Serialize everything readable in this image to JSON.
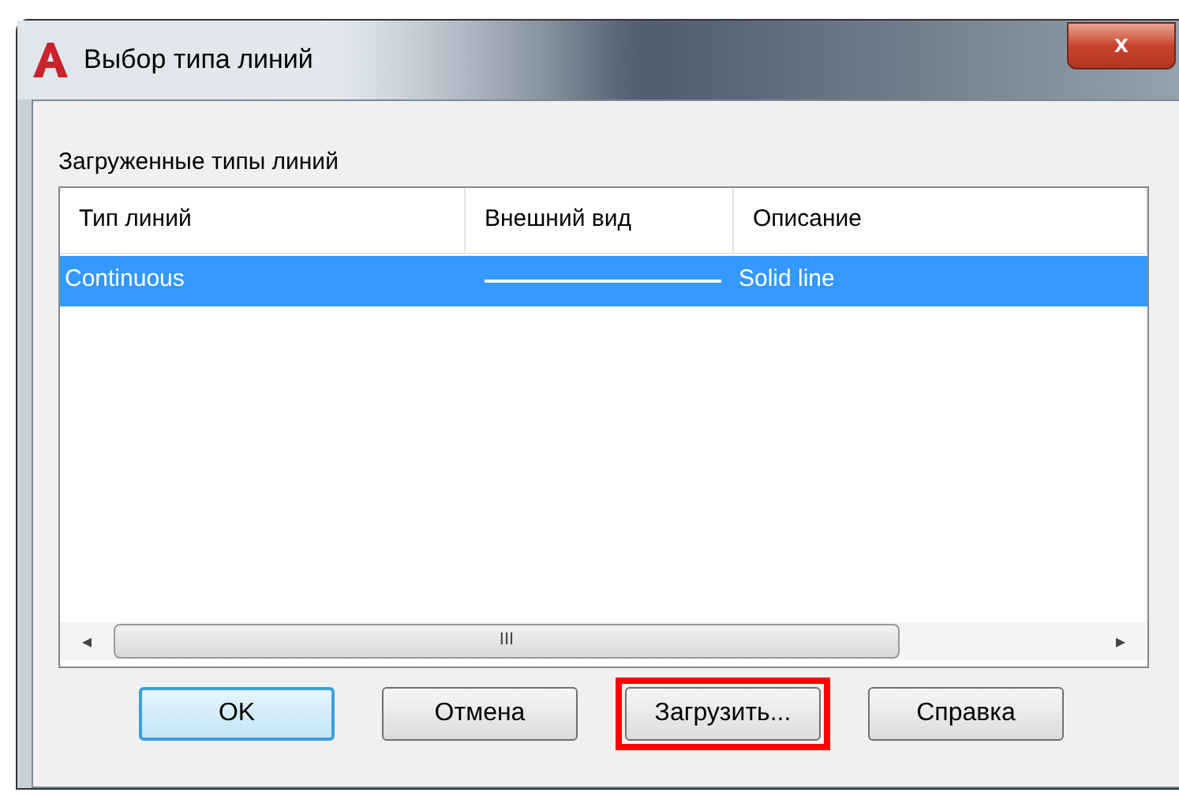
{
  "window": {
    "title": "Выбор типа линий",
    "close": "x"
  },
  "list_label": "Загруженные типы линий",
  "table": {
    "columns": [
      "Тип линий",
      "Внешний вид",
      "Описание"
    ],
    "rows": [
      {
        "name": "Continuous",
        "description": "Solid line",
        "selected": true
      }
    ],
    "scrollbar": {
      "grip": "III",
      "left": "◂",
      "right": "▸"
    }
  },
  "buttons": [
    {
      "label": "OK",
      "default": true,
      "highlighted": false
    },
    {
      "label": "Отмена",
      "default": false,
      "highlighted": false
    },
    {
      "label": "Загрузить...",
      "default": false,
      "highlighted": true
    },
    {
      "label": "Справка",
      "default": false,
      "highlighted": false
    }
  ]
}
